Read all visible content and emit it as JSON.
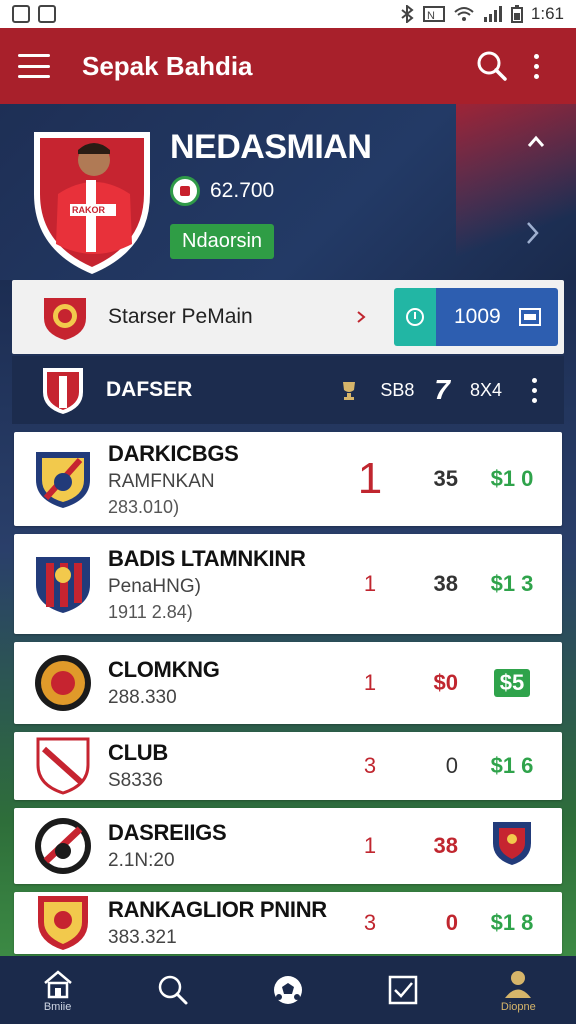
{
  "status_bar": {
    "time": "1:61"
  },
  "app_bar": {
    "title": "Sepak Bahdia"
  },
  "hero": {
    "player_name": "NEDASMIAN",
    "stat_value": "62.700",
    "badge": "Ndaorsin",
    "shirt_text": "RAKOR"
  },
  "starter": {
    "label": "Starser PeMain",
    "value": "1009"
  },
  "team_header": {
    "name": "DAFSER",
    "v1": "SB8",
    "v2": "7",
    "v3": "8X4"
  },
  "rows": [
    {
      "name": "DARKICBGS",
      "sub": "RAMFNKAN",
      "extra": "283.010)",
      "c1": "1",
      "c2": "35",
      "c3": "$1 0",
      "c1_color": "#b8242c",
      "c1_large": true
    },
    {
      "name": "BADIS LTAMNKINR",
      "sub": "PenaHNG)",
      "extra": "1911 2.84)",
      "c1": "1",
      "c2": "38",
      "c3": "$1 3",
      "c1_color": "#c0262f"
    },
    {
      "name": "CLOMKNG",
      "sub": "288.330",
      "extra": "",
      "c1": "1",
      "c2": "$0",
      "c3": "$5",
      "c1_color": "#c0262f",
      "c2_color": "#c0262f",
      "c3_boxed": true
    },
    {
      "name": "CLUB",
      "sub": "S8336",
      "extra": "",
      "c1": "3",
      "c2": "0",
      "c3": "$1 6",
      "c1_color": "#c0262f"
    },
    {
      "name": "DASREIIGS",
      "sub": "2.1N:20",
      "extra": "",
      "c1": "1",
      "c2": "38",
      "c3": "",
      "c1_color": "#c0262f",
      "c2_color": "#c0262f",
      "c3_crest": true
    },
    {
      "name": "RANKAGLIOR PNINR",
      "sub": "383.321",
      "extra": "",
      "c1": "3",
      "c2": "0",
      "c3": "$1 8",
      "c1_color": "#c0262f",
      "c2_color": "#c0262f"
    }
  ],
  "bottom_nav": [
    {
      "label": "Bmiie",
      "icon": "home-icon"
    },
    {
      "label": "",
      "icon": "search-icon"
    },
    {
      "label": "",
      "icon": "football-icon"
    },
    {
      "label": "",
      "icon": "checkbox-icon"
    },
    {
      "label": "Diopne",
      "icon": "person-icon"
    }
  ],
  "colors": {
    "app_bar": "#a8202b",
    "hero_bg": "#1e2f55",
    "accent_green": "#2f9a48",
    "accent_blue": "#2d5eb0",
    "accent_teal": "#22b6a4",
    "nav_active": "#d6b56a"
  }
}
